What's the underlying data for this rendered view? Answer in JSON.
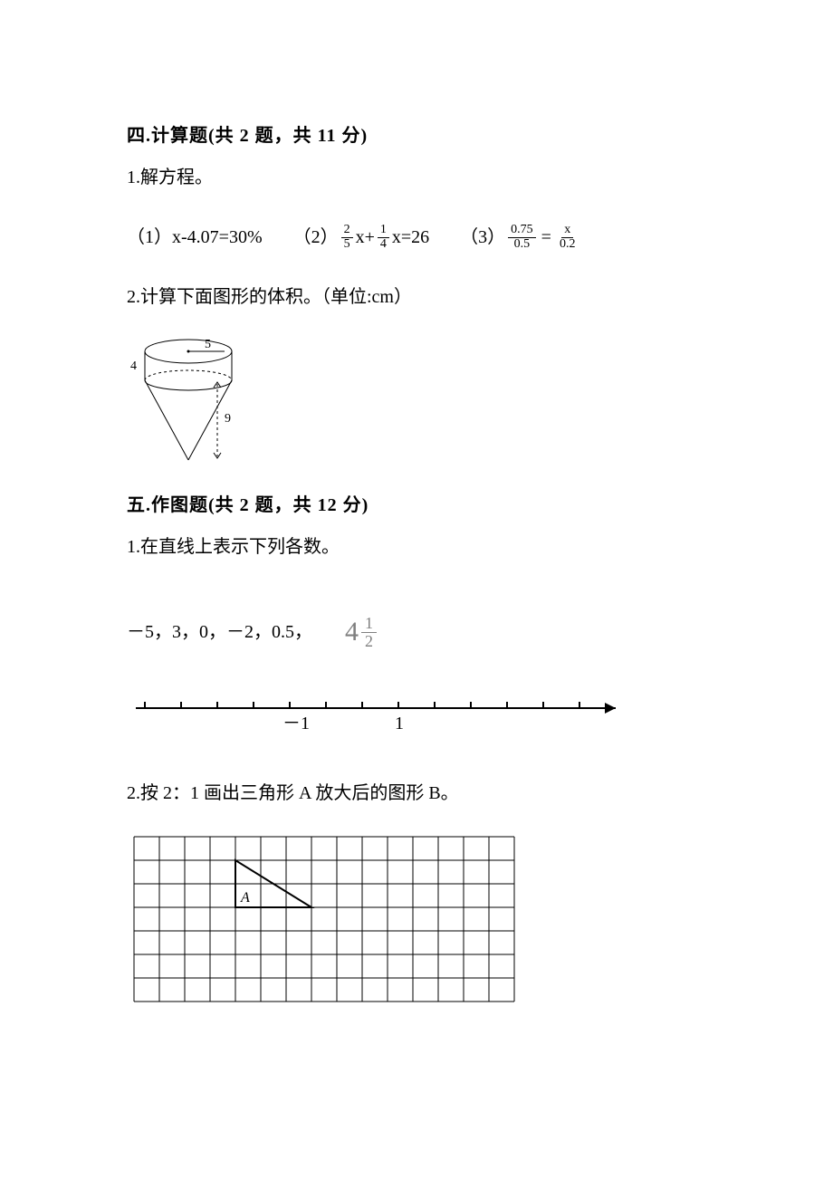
{
  "section4": {
    "heading": "四.计算题(共 2 题，共 11 分)",
    "q1": {
      "prompt": "1.解方程。",
      "part1_label": "（1）",
      "part1_eq": "x-4.07=30%",
      "part2_label": "（2）",
      "part2_frac1_num": "2",
      "part2_frac1_den": "5",
      "part2_mid": "x+",
      "part2_frac2_num": "1",
      "part2_frac2_den": "4",
      "part2_tail": "x=26",
      "part3_label": "（3）",
      "part3_lhs_num": "0.75",
      "part3_lhs_den": "0.5",
      "part3_eq": "=",
      "part3_rhs_num": "x",
      "part3_rhs_den": "0.2"
    },
    "q2": {
      "prompt": "2.计算下面图形的体积。（单位:cm）",
      "label_r": "5",
      "label_h1": "4",
      "label_h2": "9"
    }
  },
  "section5": {
    "heading": "五.作图题(共 2 题，共 12 分)",
    "q1": {
      "prompt": "1.在直线上表示下列各数。",
      "numbers_prefix": "－5，3，0，－2，0.5，",
      "mixed_whole": "4",
      "mixed_num": "1",
      "mixed_den": "2",
      "axis_neg1": "－1",
      "axis_pos1": "1"
    },
    "q2": {
      "prompt": "2.按 2：1 画出三角形 A 放大后的图形 B。",
      "grid_label": "A"
    }
  }
}
